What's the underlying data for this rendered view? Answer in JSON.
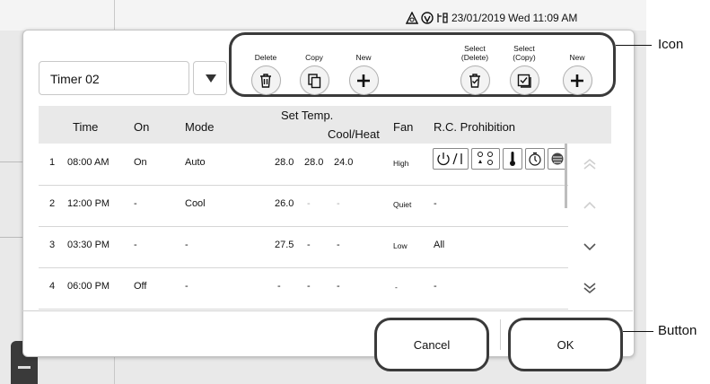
{
  "status": {
    "date": "23/01/2019",
    "day": "Wed",
    "time": "11:09 AM"
  },
  "timer": {
    "name": "Timer 02",
    "dropdown_icon": "triangle-down-icon"
  },
  "toolbar": {
    "delete_label": "Delete",
    "copy_label": "Copy",
    "new_label": "New",
    "select_delete_label": "Select\n(Delete)",
    "select_copy_label": "Select\n(Copy)",
    "new2_label": "New"
  },
  "annotations": {
    "icon": "Icon",
    "button": "Button"
  },
  "table": {
    "headers": {
      "time": "Time",
      "on": "On",
      "mode": "Mode",
      "set_temp": "Set Temp.",
      "cool_heat": "Cool/Heat",
      "fan": "Fan",
      "rc": "R.C. Prohibition"
    },
    "rows": [
      {
        "num": "1",
        "time": "08:00 AM",
        "on": "On",
        "mode": "Auto",
        "t1": "28.0",
        "t2": "28.0",
        "t3": "24.0",
        "fan": "High",
        "rc": ""
      },
      {
        "num": "2",
        "time": "12:00 PM",
        "on": "-",
        "mode": "Cool",
        "t1": "26.0",
        "t2": "-",
        "t3": "-",
        "fan": "Quiet",
        "rc": "-"
      },
      {
        "num": "3",
        "time": "03:30 PM",
        "on": "-",
        "mode": "-",
        "t1": "27.5",
        "t2": "-",
        "t3": "-",
        "fan": "Low",
        "rc": "All"
      },
      {
        "num": "4",
        "time": "06:00 PM",
        "on": "Off",
        "mode": "-",
        "t1": "-",
        "t2": "-",
        "t3": "-",
        "fan": "-",
        "rc": "-"
      }
    ],
    "prohibition_icons": [
      "on-off-icon",
      "mode-icon",
      "thermometer-icon",
      "timer-icon",
      "filter-icon"
    ]
  },
  "buttons": {
    "cancel": "Cancel",
    "ok": "OK"
  },
  "colors": {
    "frame": "#3a3a3a",
    "header_bg": "#e9e9e9"
  }
}
